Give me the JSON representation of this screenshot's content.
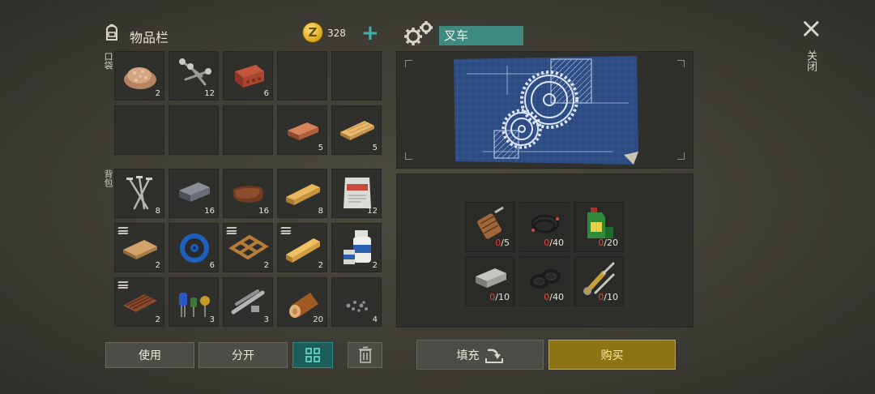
{
  "inventory": {
    "title": "物品栏",
    "coins": "328",
    "pocket_label": "口袋",
    "backpack_label": "背包",
    "pocket": [
      {
        "name": "sawdust-item",
        "qty": "2"
      },
      {
        "name": "screws-item",
        "qty": "12"
      },
      {
        "name": "brick-item",
        "qty": "6"
      },
      {
        "name": "empty",
        "qty": ""
      },
      {
        "name": "empty",
        "qty": ""
      },
      {
        "name": "empty",
        "qty": ""
      },
      {
        "name": "empty",
        "qty": ""
      },
      {
        "name": "empty",
        "qty": ""
      },
      {
        "name": "copper-bar-item",
        "qty": "5"
      },
      {
        "name": "wood-plank-item",
        "qty": "5"
      }
    ],
    "backpack": [
      {
        "name": "nails-item",
        "qty": "8"
      },
      {
        "name": "iron-bar-item",
        "qty": "16"
      },
      {
        "name": "leather-item",
        "qty": "16"
      },
      {
        "name": "plank-item",
        "qty": "8"
      },
      {
        "name": "cement-sack-item",
        "qty": "12"
      },
      {
        "name": "plywood-item",
        "qty": "2"
      },
      {
        "name": "wire-spool-item",
        "qty": "6"
      },
      {
        "name": "wooden-frame-item",
        "qty": "2"
      },
      {
        "name": "wood-beam-item",
        "qty": "2"
      },
      {
        "name": "resin-bottle-item",
        "qty": "2"
      },
      {
        "name": "corrugated-sheet-item",
        "qty": "2"
      },
      {
        "name": "electronic-parts-item",
        "qty": "3"
      },
      {
        "name": "metal-pipes-item",
        "qty": "3"
      },
      {
        "name": "log-item",
        "qty": "20"
      },
      {
        "name": "gravel-item",
        "qty": "4"
      }
    ]
  },
  "buttons": {
    "use": "使用",
    "split": "分开",
    "fill": "填充",
    "buy": "购买"
  },
  "craft": {
    "item_name": "叉车",
    "requirements": [
      {
        "name": "electric-motor-item",
        "have": "0",
        "need": "/5"
      },
      {
        "name": "wires-item",
        "have": "0",
        "need": "/40"
      },
      {
        "name": "oil-canister-item",
        "have": "0",
        "need": "/20"
      },
      {
        "name": "steel-ingot-item",
        "have": "0",
        "need": "/10"
      },
      {
        "name": "rubber-seals-item",
        "have": "0",
        "need": "/40"
      },
      {
        "name": "hydraulic-cylinder-item",
        "have": "0",
        "need": "/10"
      }
    ]
  },
  "close_label": "关闭",
  "colors": {
    "accent": "#3fb3a8",
    "buy": "#8c7414",
    "missing": "#e0443a",
    "blueprint": "#2c4b82"
  }
}
